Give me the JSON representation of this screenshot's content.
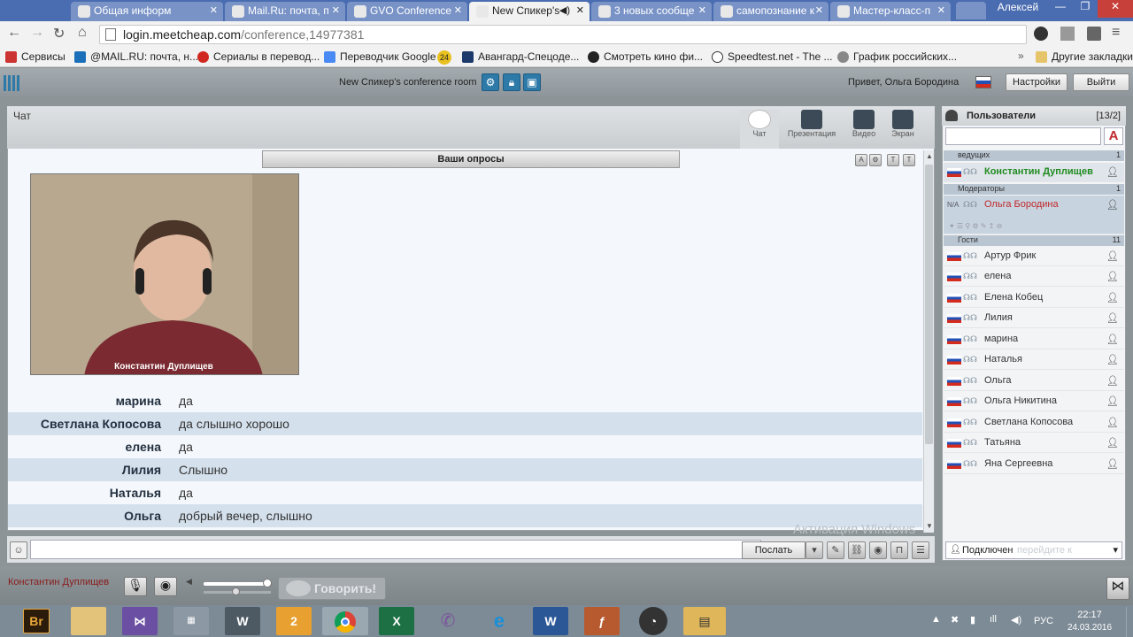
{
  "browser": {
    "tabs": [
      {
        "label": "Общая информ"
      },
      {
        "label": "Mail.Ru: почта, п"
      },
      {
        "label": "GVO Conference"
      },
      {
        "label": "New Спикер's"
      },
      {
        "label": "3 новых сообще"
      },
      {
        "label": "самопознание к"
      },
      {
        "label": "Мастер-класс-п"
      }
    ],
    "profile": "Алексей",
    "url_host": "login.meetcheap.com",
    "url_path": "/conference,14977381",
    "bookmarks": [
      "Сервисы",
      "@MAIL.RU: почта, н...",
      "Сериалы в перевод...",
      "Переводчик Google",
      "24",
      "Авангард-Спецоде...",
      "Смотреть кино фи...",
      "Speedtest.net - The ...",
      "График российских...",
      "Другие закладки"
    ]
  },
  "app": {
    "room_title": "New Спикер's conference room",
    "greeting": "Привет, Ольга Бородина",
    "settings_label": "Настройки",
    "logout_label": "Выйти",
    "panel_title": "Чат",
    "modes": [
      "Чат",
      "Презентация",
      "Видео",
      "Экран"
    ],
    "polls_label": "Ваши опросы",
    "video_caption": "Константин Дуплищев",
    "messages": [
      {
        "name": "марина",
        "text": "да"
      },
      {
        "name": "Светлана Копосова",
        "text": "да слышно хорошо"
      },
      {
        "name": "елена",
        "text": "да"
      },
      {
        "name": "Лилия",
        "text": "Слышно"
      },
      {
        "name": "Наталья",
        "text": "да"
      },
      {
        "name": "Ольга",
        "text": "добрый вечер, слышно"
      }
    ],
    "send_label": "Послать",
    "watermark": "Активация Windows",
    "watermark_sub": "перейдите к"
  },
  "users": {
    "title": "Пользователи",
    "count": "[13/2]",
    "groups": {
      "host": "ведущих",
      "host_count": "1",
      "moderators": "Модераторы",
      "moderators_count": "1",
      "guests": "Гости",
      "guests_count": "11"
    },
    "host": "Константин Дуплищев",
    "moderator": "Ольга Бородина",
    "moderator_tag": "N/A",
    "guests": [
      "Артур Фрик",
      "елена",
      "Елена Кобец",
      "Лилия",
      "марина",
      "Наталья",
      "Ольга",
      "Ольга Никитина",
      "Светлана Копосова",
      "Татьяна",
      "Яна Сергеевна"
    ],
    "status": "Подключен"
  },
  "bottom": {
    "speaker": "Константин Дуплищев",
    "talk_label": "Говорить!",
    "volume": 0.95
  },
  "taskbar": {
    "lang": "РУС",
    "time": "22:17",
    "date": "24.03.2016"
  },
  "colors": {
    "accent": "#2d7aa8",
    "host_name": "#1f8a1f",
    "moderator_name": "#c0282d",
    "chat_alt_row": "#d4e0ec"
  }
}
